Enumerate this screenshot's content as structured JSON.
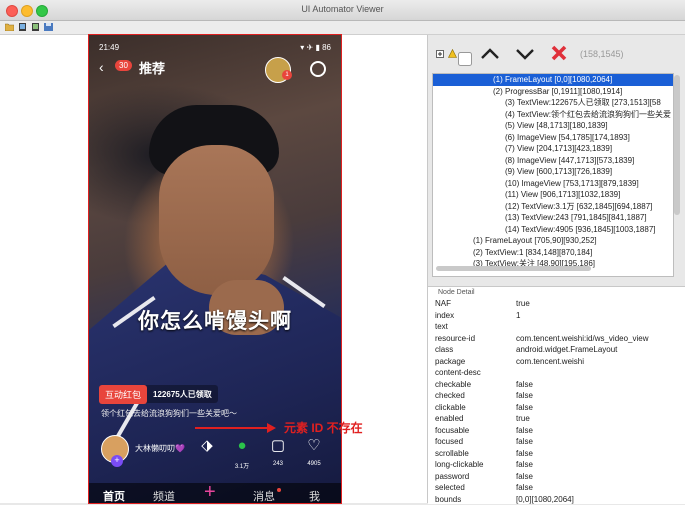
{
  "window": {
    "title": "UI Automator Viewer"
  },
  "device": {
    "status_time": "21:49",
    "battery": "86",
    "unread_count": "30",
    "top_tab": "推荐",
    "avatar_badge": "1",
    "subtitle": "你怎么啃馒头啊",
    "red_packet_tag": "互动红包",
    "red_packet_text": "122675人已领取",
    "caption": "领个红包去给流浪狗狗们一些关爱吧～",
    "author_name": "大林懒叨叨💜",
    "actions": [
      {
        "icon": "tag-icon",
        "count": ""
      },
      {
        "icon": "wechat-icon",
        "count": "3.1万"
      },
      {
        "icon": "comment-icon",
        "count": "243"
      },
      {
        "icon": "heart-icon",
        "count": "4905"
      }
    ],
    "nav": [
      "首页",
      "频道",
      "消息",
      "我"
    ],
    "nav_plus": "+"
  },
  "annotation": {
    "text": "元素 ID 不存在",
    "color": "#e02020"
  },
  "toolbar_right": {
    "coords": "(158,1545)"
  },
  "tree": [
    "(1) FrameLayout [0,0][1080,2064]",
    "(2) ProgressBar [0,1911][1080,1914]",
    "(3) TextView:122675人已领取 [273,1513][58",
    "(4) TextView:领个红包去给流浪狗狗们一些关爱",
    "(5) View [48,1713][180,1839]",
    "(6) ImageView [54,1785][174,1893]",
    "(7) View [204,1713][423,1839]",
    "(8) ImageView [447,1713][573,1839]",
    "(9) View [600,1713][726,1839]",
    "(10) ImageView [753,1713][879,1839]",
    "(11) View [906,1713][1032,1839]",
    "(12) TextView:3.1万 [632,1845][694,1887]",
    "(13) TextView:243 [791,1845][841,1887]",
    "(14) TextView:4905 [936,1845][1003,1887]",
    "(1) FrameLayout [705,90][930,252]",
    "(2) TextView:1 [834,148][870,184]",
    "(3) TextView:关注 [48,90][195,186]"
  ],
  "node_detail": {
    "title": "Node Detail",
    "rows": [
      {
        "key": "NAF",
        "value": "true"
      },
      {
        "key": "index",
        "value": "1"
      },
      {
        "key": "text",
        "value": ""
      },
      {
        "key": "resource-id",
        "value": "com.tencent.weishi:id/ws_video_view"
      },
      {
        "key": "class",
        "value": "android.widget.FrameLayout"
      },
      {
        "key": "package",
        "value": "com.tencent.weishi"
      },
      {
        "key": "content-desc",
        "value": ""
      },
      {
        "key": "checkable",
        "value": "false"
      },
      {
        "key": "checked",
        "value": "false"
      },
      {
        "key": "clickable",
        "value": "false"
      },
      {
        "key": "enabled",
        "value": "true"
      },
      {
        "key": "focusable",
        "value": "false"
      },
      {
        "key": "focused",
        "value": "false"
      },
      {
        "key": "scrollable",
        "value": "false"
      },
      {
        "key": "long-clickable",
        "value": "false"
      },
      {
        "key": "password",
        "value": "false"
      },
      {
        "key": "selected",
        "value": "false"
      },
      {
        "key": "bounds",
        "value": "[0,0][1080,2064]"
      }
    ]
  }
}
